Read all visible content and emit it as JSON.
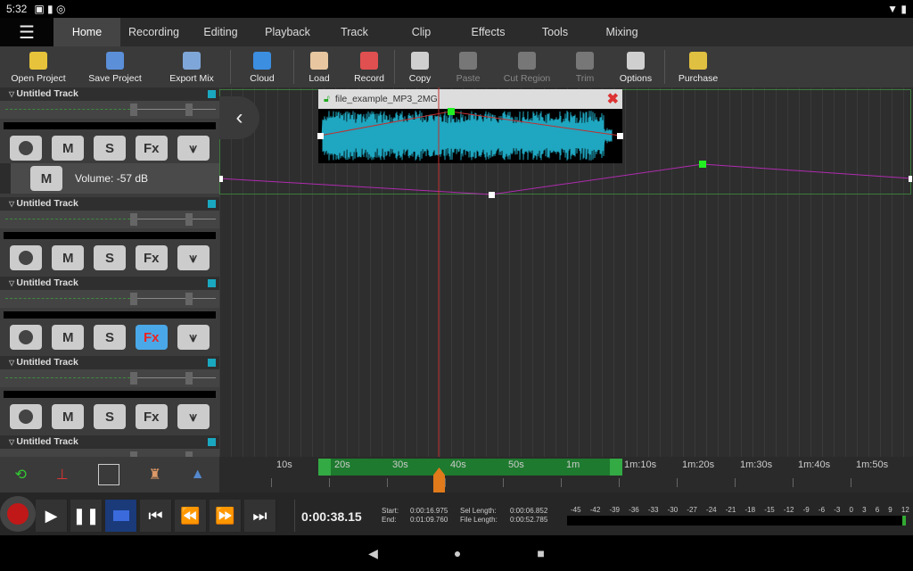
{
  "status": {
    "time": "5:32"
  },
  "tabs": [
    "Home",
    "Recording",
    "Editing",
    "Playback",
    "Track",
    "Clip",
    "Effects",
    "Tools",
    "Mixing"
  ],
  "toolbar": [
    {
      "label": "Open Project",
      "icon": "open-folder-icon",
      "color": "#e6c33a",
      "enabled": true,
      "w": 86
    },
    {
      "label": "Save Project",
      "icon": "save-icon",
      "color": "#5b8fd8",
      "enabled": true,
      "w": 86
    },
    {
      "label": "Export Mix",
      "icon": "export-mix-icon",
      "color": "#7fa6d8",
      "enabled": true,
      "w": 86
    },
    {
      "sep": true
    },
    {
      "label": "Cloud",
      "icon": "cloud-icon",
      "color": "#3c8ee0",
      "enabled": true,
      "w": 70
    },
    {
      "sep": true
    },
    {
      "label": "Load",
      "icon": "load-icon",
      "color": "#e8c7a0",
      "enabled": true,
      "w": 56
    },
    {
      "label": "Record",
      "icon": "record-file-icon",
      "color": "#e05050",
      "enabled": true,
      "w": 56
    },
    {
      "sep": true
    },
    {
      "label": "Copy",
      "icon": "copy-icon",
      "color": "#cfcfcf",
      "enabled": true,
      "w": 56
    },
    {
      "label": "Paste",
      "icon": "paste-icon",
      "color": "#777",
      "enabled": false,
      "w": 52
    },
    {
      "label": "Cut Region",
      "icon": "cut-region-icon",
      "color": "#777",
      "enabled": false,
      "w": 80
    },
    {
      "label": "Trim",
      "icon": "trim-icon",
      "color": "#777",
      "enabled": false,
      "w": 50
    },
    {
      "label": "Options",
      "icon": "options-icon",
      "color": "#cfcfcf",
      "enabled": true,
      "w": 64
    },
    {
      "sep": true
    },
    {
      "label": "Purchase",
      "icon": "purchase-icon",
      "color": "#e0c040",
      "enabled": true,
      "w": 74
    }
  ],
  "tracks": [
    {
      "name": "Untitled Track",
      "volume_label": "Volume: -57 dB",
      "fx_active": false
    },
    {
      "name": "Untitled Track",
      "fx_active": false
    },
    {
      "name": "Untitled Track",
      "fx_active": true
    },
    {
      "name": "Untitled Track",
      "fx_active": false
    },
    {
      "name": "Untitled Track"
    }
  ],
  "track_buttons": {
    "mute": "M",
    "solo": "S",
    "fx": "Fx"
  },
  "clip": {
    "name": "file_example_MP3_2MG"
  },
  "ruler": [
    "10s",
    "20s",
    "30s",
    "40s",
    "50s",
    "1m",
    "1m:10s",
    "1m:20s",
    "1m:30s",
    "1m:40s",
    "1m:50s"
  ],
  "transport": {
    "time": "0:00:38.15",
    "start_label": "Start:",
    "start": "0:00:16.975",
    "end_label": "End:",
    "end": "0:01:09.760",
    "sel_label": "Sel Length:",
    "sel": "0:00:06.852",
    "file_label": "File Length:",
    "file": "0:00:52.785"
  },
  "meter_scale": [
    "-45",
    "-42",
    "-39",
    "-36",
    "-33",
    "-30",
    "-27",
    "-24",
    "-21",
    "-18",
    "-15",
    "-12",
    "-9",
    "-6",
    "-3",
    "0",
    "3",
    "6",
    "9",
    "12"
  ]
}
